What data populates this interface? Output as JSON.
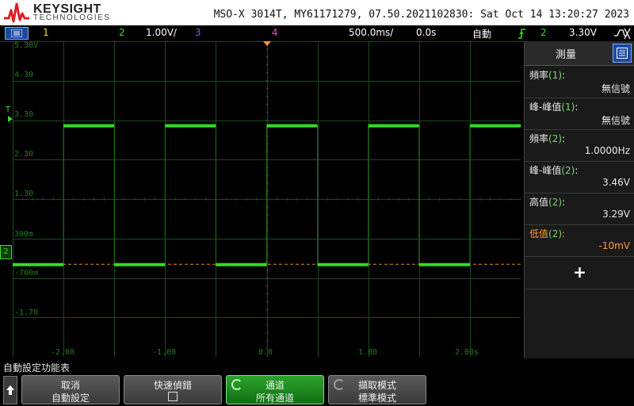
{
  "header": {
    "brand": "KEYSIGHT",
    "brand_sub": "TECHNOLOGIES",
    "instrument": "MSO-X 3014T, MY61171279, 07.50.2021102830: Sat Oct 14 13:20:27 2023"
  },
  "status": {
    "ch1": "1",
    "ch2": "2",
    "ch2_scale": "1.00V/",
    "ch3": "3",
    "ch4": "4",
    "timebase": "500.0ms/",
    "delay": "0.0s",
    "trigger_mode": "自動",
    "trigger_channel": "2",
    "trigger_level": "3.30V"
  },
  "plot": {
    "y_labels": [
      "5.30V",
      "4.30",
      "3.30",
      "2.30",
      "1.30",
      "300m",
      "-700m",
      "-1.70"
    ],
    "x_labels": [
      "-2.00",
      "-1.00",
      "0.0",
      "1.00",
      "2.00s"
    ],
    "channel_marker": "2",
    "trigger_marker": "T",
    "colors": {
      "trace": "#33dd22",
      "grid": "#1c4a1c",
      "ref": "#e08a1e",
      "label": "#1e7f1e"
    }
  },
  "chart_data": {
    "type": "line",
    "title": "",
    "xlabel": "",
    "ylabel": "",
    "x_unit": "s",
    "y_unit": "V",
    "xlim": [
      -2.5,
      2.5
    ],
    "ylim": [
      -2.2,
      5.3
    ],
    "series": [
      {
        "channel": "2",
        "x": [
          -2.5,
          -2.0,
          -2.0,
          -1.5,
          -1.5,
          -1.0,
          -1.0,
          -0.5,
          -0.5,
          0.0,
          0.0,
          0.5,
          0.5,
          1.0,
          1.0,
          1.5,
          1.5,
          2.0,
          2.0,
          2.5
        ],
        "y": [
          -0.01,
          -0.01,
          3.29,
          3.29,
          -0.01,
          -0.01,
          3.29,
          3.29,
          -0.01,
          -0.01,
          3.29,
          3.29,
          -0.01,
          -0.01,
          3.29,
          3.29,
          -0.01,
          -0.01,
          3.29,
          3.29
        ]
      }
    ]
  },
  "panel": {
    "title": "測量",
    "measurements": [
      {
        "name": "頻率",
        "ch": "(1)",
        "value": "無信號"
      },
      {
        "name": "峰-峰值",
        "ch": "(1)",
        "value": "無信號"
      },
      {
        "name": "頻率",
        "ch": "(2)",
        "value": "1.0000Hz"
      },
      {
        "name": "峰-峰值",
        "ch": "(2)",
        "value": "3.46V"
      },
      {
        "name": "高值",
        "ch": "(2)",
        "value": "3.29V"
      },
      {
        "name": "低值",
        "ch": "(2)",
        "value": "-10mV"
      }
    ],
    "add_label": "+"
  },
  "softkeys": {
    "title": "自動設定功能表",
    "keys": [
      {
        "line1": "取消",
        "line2": "自動設定"
      },
      {
        "line1": "快速偵錯",
        "line2": ""
      },
      {
        "line1": "通道",
        "line2": "所有通道"
      },
      {
        "line1": "擷取模式",
        "line2": "標準模式"
      }
    ]
  }
}
